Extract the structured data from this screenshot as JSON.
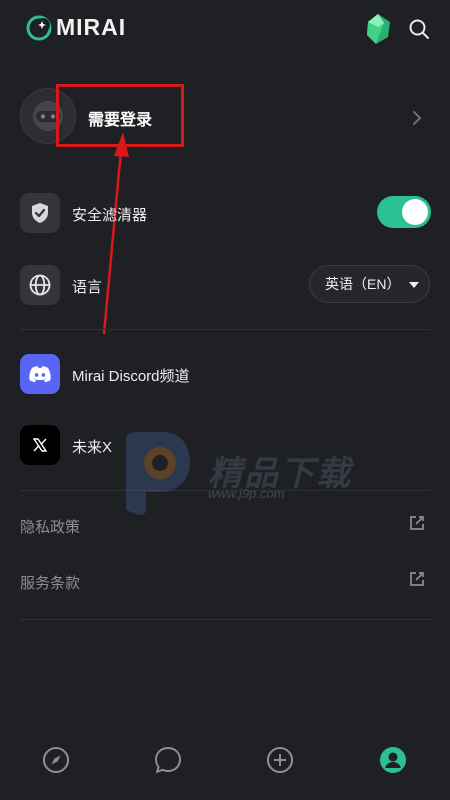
{
  "header": {
    "app_name": "MIRAI"
  },
  "profile": {
    "login_label": "需要登录"
  },
  "settings": {
    "safety_filter": {
      "label": "安全滤清器",
      "enabled": true
    },
    "language": {
      "label": "语言",
      "selected": "英语（EN）"
    }
  },
  "social": {
    "discord_label": "Mirai Discord频道",
    "x_label": "未来X"
  },
  "links": {
    "privacy": "隐私政策",
    "terms": "服务条款"
  },
  "watermark": {
    "brand": "精品下载",
    "url": "www.j9p.com"
  },
  "colors": {
    "accent": "#2dbf94",
    "background": "#1f2023",
    "annotation": "#d81919",
    "discord": "#5865f2"
  },
  "bottom_nav": {
    "active": "profile"
  }
}
